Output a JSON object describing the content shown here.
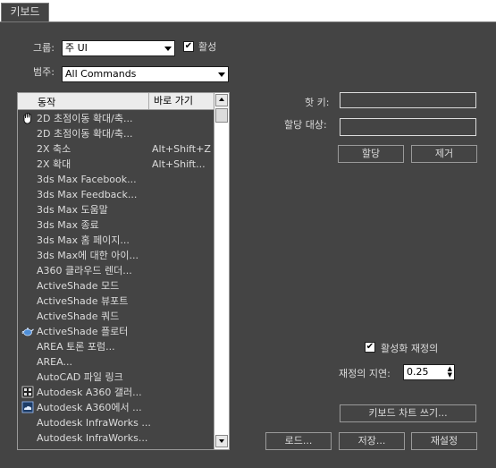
{
  "tabs": [
    {
      "label": "키보드"
    }
  ],
  "group": {
    "label": "그룹:",
    "value": "주 UI"
  },
  "active": {
    "label": "활성",
    "checked": true
  },
  "category": {
    "label": "범주:",
    "value": "All Commands"
  },
  "list": {
    "headers": {
      "action": "동작",
      "shortcut": "바로 가기"
    },
    "rows": [
      {
        "icon": "hand-icon",
        "name": "2D 초점이동 확대/축...",
        "shortcut": ""
      },
      {
        "icon": "",
        "name": "2D 초점이동 확대/축...",
        "shortcut": ""
      },
      {
        "icon": "",
        "name": "2X 축소",
        "shortcut": "Alt+Shift+Z"
      },
      {
        "icon": "",
        "name": "2X 확대",
        "shortcut": "Alt+Shift..."
      },
      {
        "icon": "",
        "name": "3ds Max Facebook...",
        "shortcut": ""
      },
      {
        "icon": "",
        "name": "3ds Max Feedback...",
        "shortcut": ""
      },
      {
        "icon": "",
        "name": "3ds Max 도움말",
        "shortcut": ""
      },
      {
        "icon": "",
        "name": "3ds Max 종료",
        "shortcut": ""
      },
      {
        "icon": "",
        "name": "3ds Max 홈 페이지...",
        "shortcut": ""
      },
      {
        "icon": "",
        "name": "3ds Max에 대한 아이...",
        "shortcut": ""
      },
      {
        "icon": "",
        "name": "A360 클라우드 렌더...",
        "shortcut": ""
      },
      {
        "icon": "",
        "name": "ActiveShade 모드",
        "shortcut": ""
      },
      {
        "icon": "",
        "name": "ActiveShade 뷰포트",
        "shortcut": ""
      },
      {
        "icon": "",
        "name": "ActiveShade 쿼드",
        "shortcut": ""
      },
      {
        "icon": "teapot-icon",
        "name": "ActiveShade 플로터",
        "shortcut": ""
      },
      {
        "icon": "",
        "name": "AREA 토론 포럼...",
        "shortcut": ""
      },
      {
        "icon": "",
        "name": "AREA...",
        "shortcut": ""
      },
      {
        "icon": "",
        "name": "AutoCAD 파일 링크",
        "shortcut": ""
      },
      {
        "icon": "gallery-icon",
        "name": "Autodesk A360 갤러...",
        "shortcut": ""
      },
      {
        "icon": "cloud-icon",
        "name": "Autodesk A360에서 ...",
        "shortcut": ""
      },
      {
        "icon": "",
        "name": "Autodesk InfraWorks ...",
        "shortcut": ""
      },
      {
        "icon": "",
        "name": "Autodesk InfraWorks...",
        "shortcut": ""
      }
    ]
  },
  "hotkey": {
    "label": "핫 키:",
    "value": ""
  },
  "assigned_to": {
    "label": "할당 대상:",
    "value": ""
  },
  "buttons": {
    "assign": "할당",
    "remove": "제거",
    "write_chart": "키보드 차트 쓰기...",
    "load": "로드...",
    "save": "저장...",
    "reset": "재설정"
  },
  "reinit": {
    "label": "활성화 재정의",
    "checked": true
  },
  "delay": {
    "label": "재정의 지연:",
    "value": "0.25"
  },
  "colors": {
    "panel_bg": "#444444",
    "text": "#dcdcdc",
    "border": "#9a9a9a"
  }
}
